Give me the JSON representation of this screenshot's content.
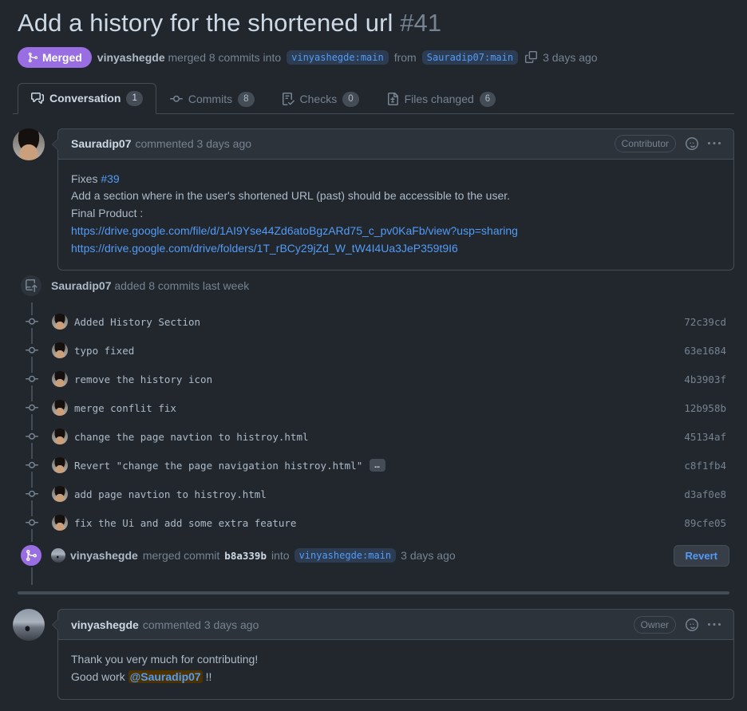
{
  "header": {
    "title": "Add a history for the shortened url",
    "number": "#41",
    "state": "Merged",
    "merged_by": "vinyashegde",
    "merged_text_1": "merged 8 commits into",
    "base_branch": "vinyashegde:main",
    "from_label": "from",
    "head_branch": "Sauradip07:main",
    "time": "3 days ago"
  },
  "tabs": [
    {
      "label": "Conversation",
      "count": "1",
      "icon": "comment-discussion-icon",
      "active": true
    },
    {
      "label": "Commits",
      "count": "8",
      "icon": "git-commit-icon",
      "active": false
    },
    {
      "label": "Checks",
      "count": "0",
      "icon": "checklist-icon",
      "active": false
    },
    {
      "label": "Files changed",
      "count": "6",
      "icon": "file-diff-icon",
      "active": false
    }
  ],
  "first_comment": {
    "author": "Sauradip07",
    "action": "commented",
    "time": "3 days ago",
    "role": "Contributor",
    "body": {
      "line1_prefix": "Fixes ",
      "line1_ref": "#39",
      "line2": "Add a section where in the user's shortened URL (past) should be accessible to the user.",
      "line3": "Final Product :",
      "link1": "https://drive.google.com/file/d/1AI9Yse44Zd6atoBgzARd75_c_pv0KaFb/view?usp=sharing",
      "link2": "https://drive.google.com/drive/folders/1T_rBCy29jZd_W_tW4I4Ua3JeP359t9I6"
    }
  },
  "commits_event": {
    "author": "Sauradip07",
    "text": "added 8 commits last week"
  },
  "commits": [
    {
      "message": "Added History Section",
      "sha": "72c39cd",
      "expandable": false
    },
    {
      "message": "typo fixed",
      "sha": "63e1684",
      "expandable": false
    },
    {
      "message": "remove the history icon",
      "sha": "4b3903f",
      "expandable": false
    },
    {
      "message": "merge conflit fix",
      "sha": "12b958b",
      "expandable": false
    },
    {
      "message": "change the page navtion to histroy.html",
      "sha": "45134af",
      "expandable": false
    },
    {
      "message": "Revert \"change the page navigation histroy.html\"",
      "sha": "c8f1fb4",
      "expandable": true
    },
    {
      "message": "add page navtion to histroy.html",
      "sha": "d3af0e8",
      "expandable": false
    },
    {
      "message": "fix the Ui and add some extra feature",
      "sha": "89cfe05",
      "expandable": false
    }
  ],
  "expand_label": "…",
  "merge_event": {
    "author": "vinyashegde",
    "verb": "merged commit",
    "sha": "b8a339b",
    "into": "into",
    "branch": "vinyashegde:main",
    "time": "3 days ago",
    "revert_label": "Revert"
  },
  "second_comment": {
    "author": "vinyashegde",
    "action": "commented",
    "time": "3 days ago",
    "role": "Owner",
    "body": {
      "line1": "Thank you very much for contributing!",
      "line2_prefix": "Good work ",
      "mention": "@Sauradip07",
      "line2_suffix": " !!"
    }
  },
  "colors": {
    "merged": "#986ee2",
    "link": "#539bf5",
    "background": "#22272e",
    "panel": "#2d333b",
    "border": "#444c56",
    "mention_bg": "#4b3200",
    "mention_fg": "#f0b72f"
  }
}
